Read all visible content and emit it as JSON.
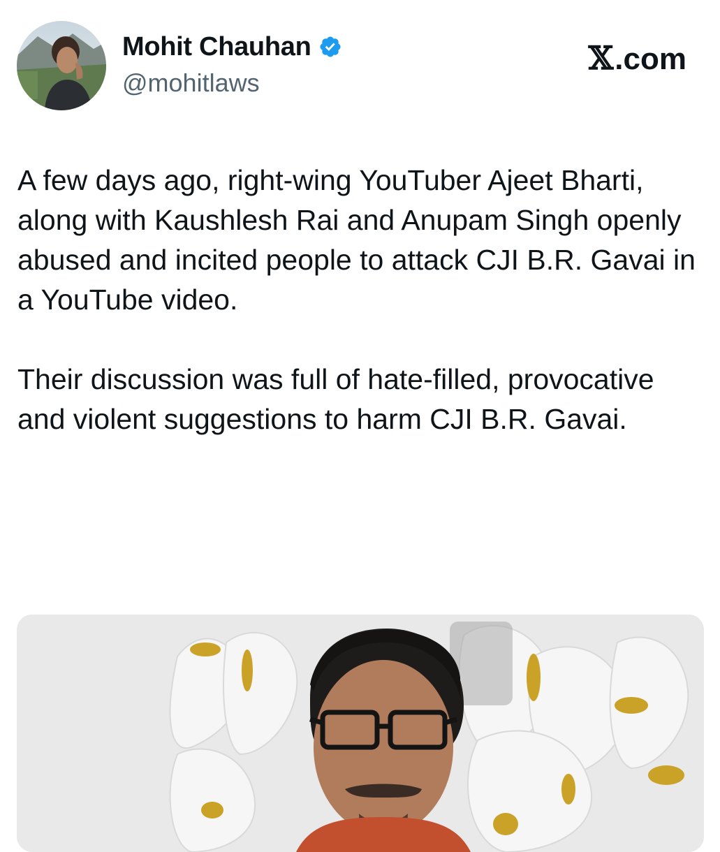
{
  "author": {
    "display_name": "Mohit Chauhan",
    "handle": "@mohitlaws",
    "verified": true,
    "avatar_icon": "profile-photo"
  },
  "brand": {
    "label": ".com",
    "icon": "x-logo-icon"
  },
  "tweet": {
    "paragraphs": [
      "A few days ago, right-wing YouTuber Ajeet Bharti, along with Kaushlesh Rai and Anupam Singh openly abused and incited people to attack CJI B.R. Gavai in a YouTube video.",
      "Their discussion was full of hate-filled, provocative and violent suggestions to harm CJI B.R. Gavai."
    ]
  },
  "colors": {
    "text": "#0f1419",
    "secondary_text": "#536471",
    "verified_badge": "#1d9bf0",
    "background": "#ffffff"
  }
}
